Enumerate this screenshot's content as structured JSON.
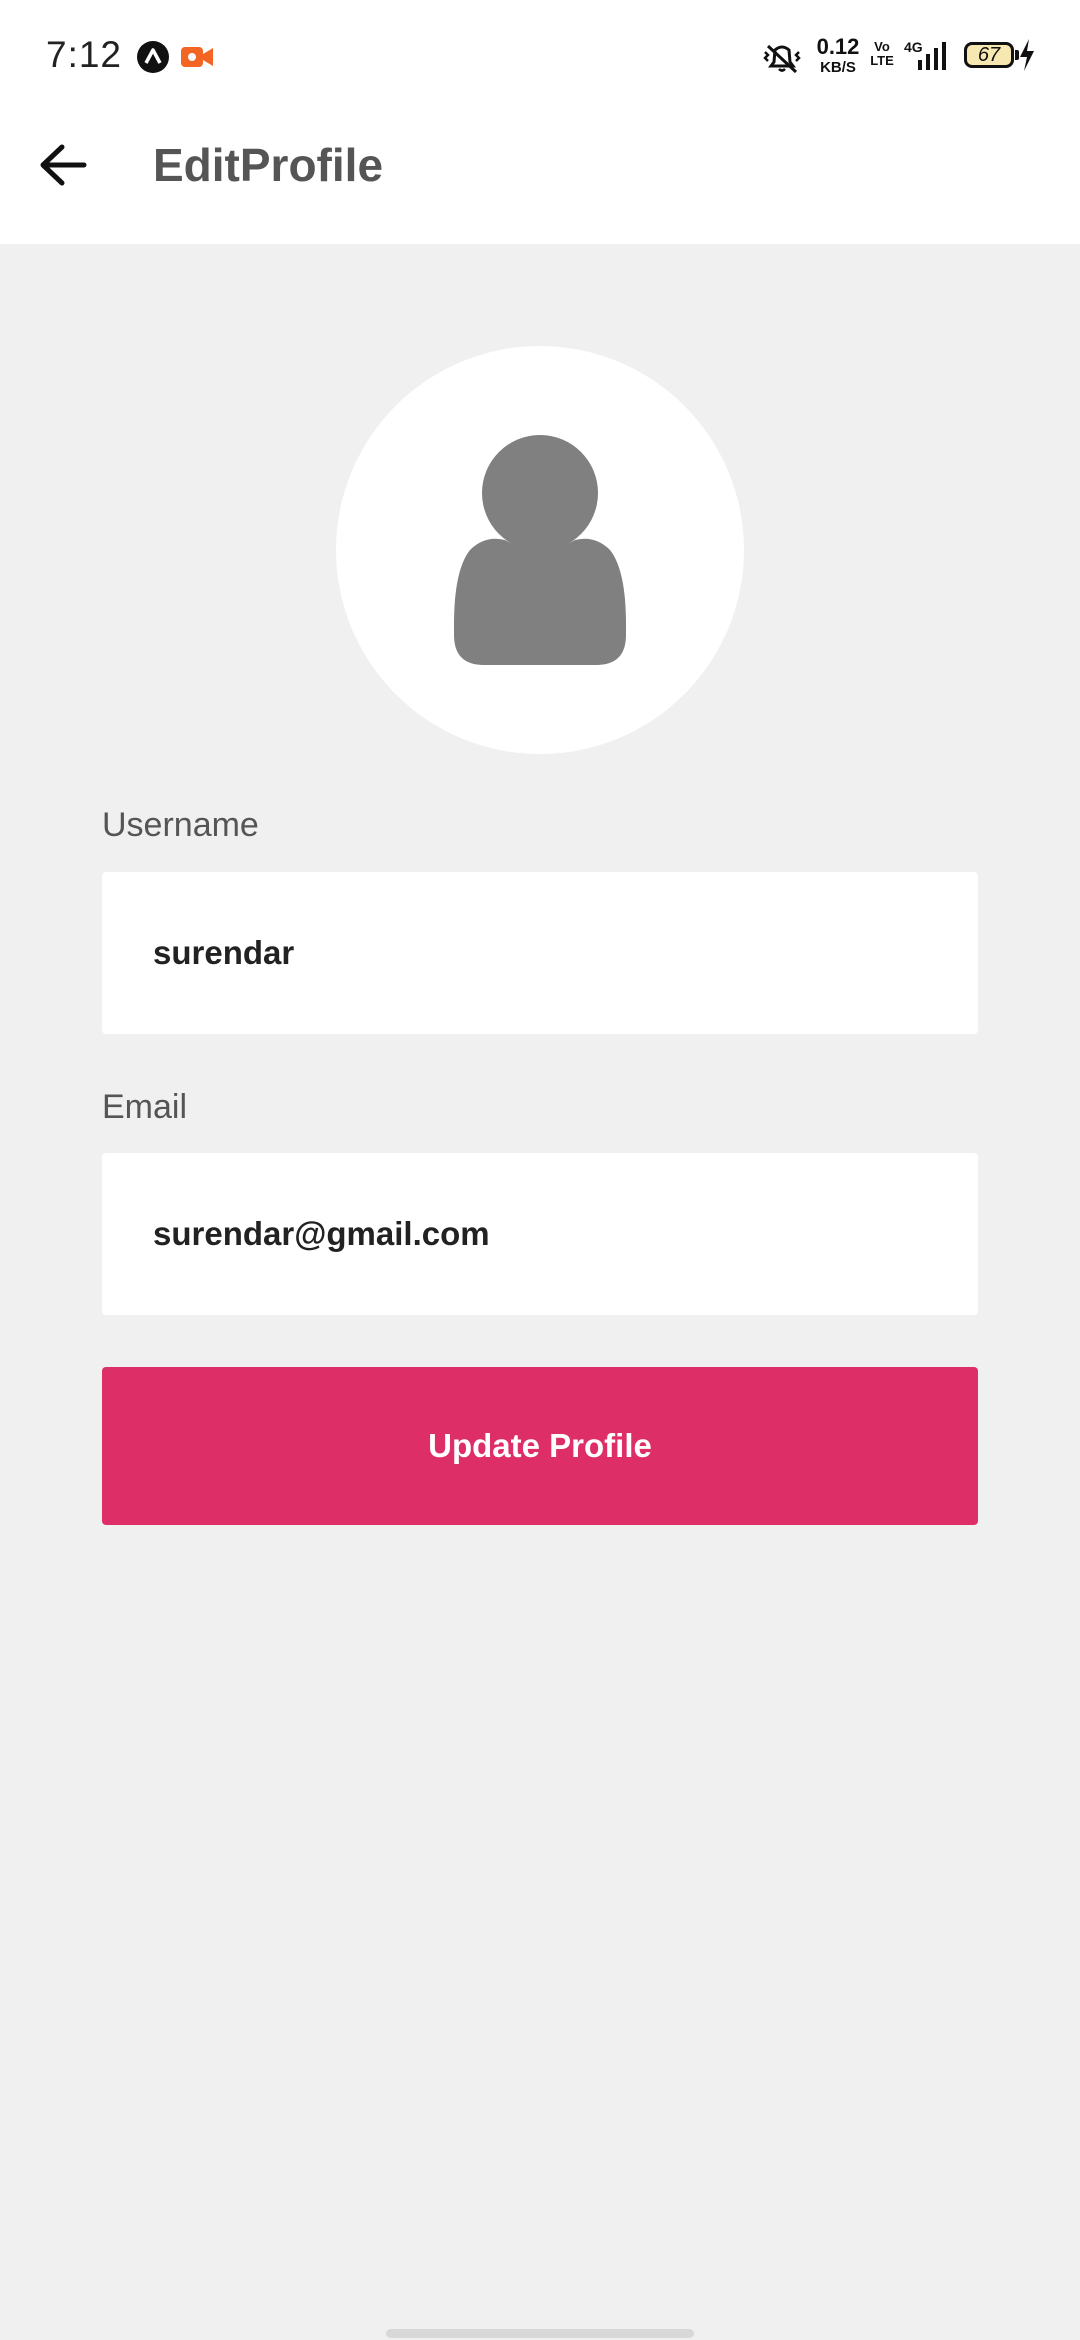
{
  "status_bar": {
    "time": "7:12",
    "net_speed_value": "0.12",
    "net_speed_unit": "KB/S",
    "volte_top": "Vo",
    "volte_bottom": "LTE",
    "network_type": "4G",
    "battery_level": "67",
    "icons": [
      "app-a-icon",
      "screen-record-icon",
      "vibrate-mute-icon",
      "signal-icon",
      "battery-icon",
      "charging-icon"
    ],
    "record_icon_color": "#f26522"
  },
  "app_bar": {
    "title": "EditProfile",
    "back_icon": "arrow-left-icon"
  },
  "profile": {
    "avatar_icon": "person-icon",
    "avatar_color": "#808080",
    "username_label": "Username",
    "username_value": "surendar",
    "email_label": "Email",
    "email_value": "surendar@gmail.com"
  },
  "actions": {
    "update_label": "Update Profile",
    "accent_color": "#de2e68"
  }
}
